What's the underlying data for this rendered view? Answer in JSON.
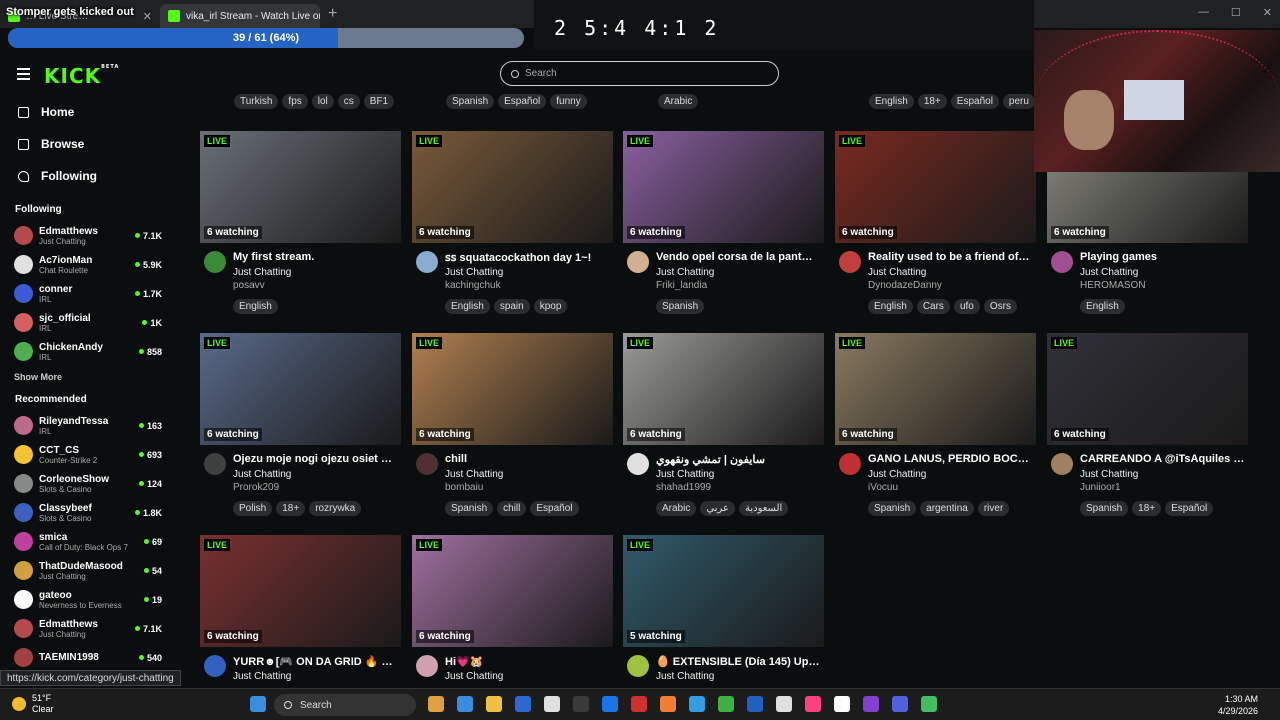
{
  "browser": {
    "tabs": [
      {
        "label": "… Live Stre…",
        "active": false
      },
      {
        "label": "vika_irl Stream - Watch Live on Kic…",
        "active": true
      }
    ],
    "new_tab": "+"
  },
  "overlay": {
    "title": "Stomper gets kicked out",
    "progress_label": "39 / 61 (64%)",
    "progress_fraction": 0.64,
    "timer": "2 5:4 4:1 2"
  },
  "header": {
    "logo": "KICK",
    "logo_badge": "BETA",
    "search_placeholder": "Search"
  },
  "nav": [
    {
      "label": "Home",
      "icon": "home-icon"
    },
    {
      "label": "Browse",
      "icon": "browse-icon"
    },
    {
      "label": "Following",
      "icon": "heart-icon"
    }
  ],
  "following": {
    "title": "Following",
    "channels": [
      {
        "name": "Edmatthews",
        "category": "Just Chatting",
        "viewers": "7.1K",
        "color": "#b54a4a"
      },
      {
        "name": "Ac7ionMan",
        "category": "Chat Roulette",
        "viewers": "5.9K",
        "color": "#e0e0e0"
      },
      {
        "name": "conner",
        "category": "IRL",
        "viewers": "1.7K",
        "color": "#3b5bd6"
      },
      {
        "name": "sjc_official",
        "category": "IRL",
        "viewers": "1K",
        "color": "#d66060"
      },
      {
        "name": "ChickenAndy",
        "category": "IRL",
        "viewers": "858",
        "color": "#4caf50"
      }
    ],
    "show_more": "Show More"
  },
  "recommended": {
    "title": "Recommended",
    "channels": [
      {
        "name": "RileyandTessa",
        "category": "IRL",
        "viewers": "163",
        "color": "#c06a8a"
      },
      {
        "name": "CCT_CS",
        "category": "Counter-Strike 2",
        "viewers": "693",
        "color": "#f4c430"
      },
      {
        "name": "CorleoneShow",
        "category": "Slots & Casino",
        "viewers": "124",
        "color": "#888888"
      },
      {
        "name": "Classybeef",
        "category": "Slots & Casino",
        "viewers": "1.8K",
        "color": "#4060c0"
      },
      {
        "name": "smica",
        "category": "Call of Duty: Black Ops 7",
        "viewers": "69",
        "color": "#c040a0"
      },
      {
        "name": "ThatDudeMasood",
        "category": "Just Chatting",
        "viewers": "54",
        "color": "#d0a040"
      },
      {
        "name": "gateoo",
        "category": "Neverness to Everness",
        "viewers": "19",
        "color": "#ffffff"
      },
      {
        "name": "Edmatthews",
        "category": "Just Chatting",
        "viewers": "7.1K",
        "color": "#b54a4a"
      },
      {
        "name": "TAEMIN1998",
        "category": "",
        "viewers": "540",
        "color": "#a04040"
      }
    ]
  },
  "top_tags": [
    [
      "Turkish",
      "fps",
      "lol",
      "cs",
      "BF1"
    ],
    [
      "Spanish",
      "Español",
      "funny"
    ],
    [
      "Arabic"
    ],
    [
      "English",
      "18+",
      "Español",
      "peru"
    ]
  ],
  "streams": [
    {
      "title": "My first stream.",
      "category": "Just Chatting",
      "user": "posavv",
      "watching": "6 watching",
      "tags": [
        "English"
      ],
      "thumb": "#6a6f78",
      "avatar": "#3a8a3a"
    },
    {
      "title": "ꜱꜱ squatacockathon day 1~!",
      "category": "Just Chatting",
      "user": "kachingchuk",
      "watching": "6 watching",
      "tags": [
        "English",
        "spain",
        "kpop"
      ],
      "thumb": "#7a5a3a",
      "avatar": "#8aaad0"
    },
    {
      "title": "Vendo opel corsa de la pant…",
      "category": "Just Chatting",
      "user": "Friki_landia",
      "watching": "6 watching",
      "tags": [
        "Spanish"
      ],
      "thumb": "#8a60a0",
      "avatar": "#d0b090"
    },
    {
      "title": "Reality used to be a friend of…",
      "category": "Just Chatting",
      "user": "DynodazeDanny",
      "watching": "6 watching",
      "tags": [
        "English",
        "Cars",
        "ufo",
        "Osrs"
      ],
      "thumb": "#7a2a20",
      "avatar": "#c04040"
    },
    {
      "title": "Playing games",
      "category": "Just Chatting",
      "user": "HEROMASON",
      "watching": "6 watching",
      "tags": [
        "English"
      ],
      "thumb": "#8a8a80",
      "avatar": "#a05090"
    },
    {
      "title": "Ojezu moje nogi ojezu osiet …",
      "category": "Just Chatting",
      "user": "Prorok209",
      "watching": "6 watching",
      "tags": [
        "Polish",
        "18+",
        "rozrywka"
      ],
      "thumb": "#5a6a8a",
      "avatar": "#404040"
    },
    {
      "title": "chill",
      "category": "Just Chatting",
      "user": "bombaiu",
      "watching": "6 watching",
      "tags": [
        "Spanish",
        "chill",
        "Español"
      ],
      "thumb": "#b08050",
      "avatar": "#503030"
    },
    {
      "title": "سايفون | تمشي ونقهوي",
      "category": "Just Chatting",
      "user": "shahad1999",
      "watching": "6 watching",
      "tags": [
        "Arabic",
        "عربي",
        "السعودية"
      ],
      "thumb": "#9a9a98",
      "avatar": "#e0e0e0"
    },
    {
      "title": "GANO LANUS, PERDIO BOC…",
      "category": "Just Chatting",
      "user": "iVocuu",
      "watching": "6 watching",
      "tags": [
        "Spanish",
        "argentina",
        "river"
      ],
      "thumb": "#8a7a60",
      "avatar": "#c03030"
    },
    {
      "title": "CARREANDO A @iTsAquiles …",
      "category": "Just Chatting",
      "user": "Juniioor1",
      "watching": "6 watching",
      "tags": [
        "Spanish",
        "18+",
        "Español"
      ],
      "thumb": "#303038",
      "avatar": "#a08060"
    },
    {
      "title": "YURR☻[🎮 ON DA GRID 🔥 …",
      "category": "Just Chatting",
      "user": "",
      "watching": "6 watching",
      "tags": [],
      "thumb": "#7a3030",
      "avatar": "#3060c0"
    },
    {
      "title": "Hi💗🐹",
      "category": "Just Chatting",
      "user": "",
      "watching": "6 watching",
      "tags": [],
      "thumb": "#a070a0",
      "avatar": "#d0a0b0"
    },
    {
      "title": "🥚 EXTENSIBLE (Día 145) Up…",
      "category": "Just Chatting",
      "user": "",
      "watching": "5 watching",
      "tags": [],
      "thumb": "#305a6a",
      "avatar": "#a0c040"
    }
  ],
  "live_label": "LIVE",
  "status_url": "https://kick.com/category/just-chatting",
  "taskbar": {
    "temp": "51°F",
    "condition": "Clear",
    "search_label": "Search",
    "time": "1:30 AM",
    "date": "4/29/2026"
  },
  "colors": {
    "accent": "#53fc18",
    "background": "#0b0e0f"
  }
}
